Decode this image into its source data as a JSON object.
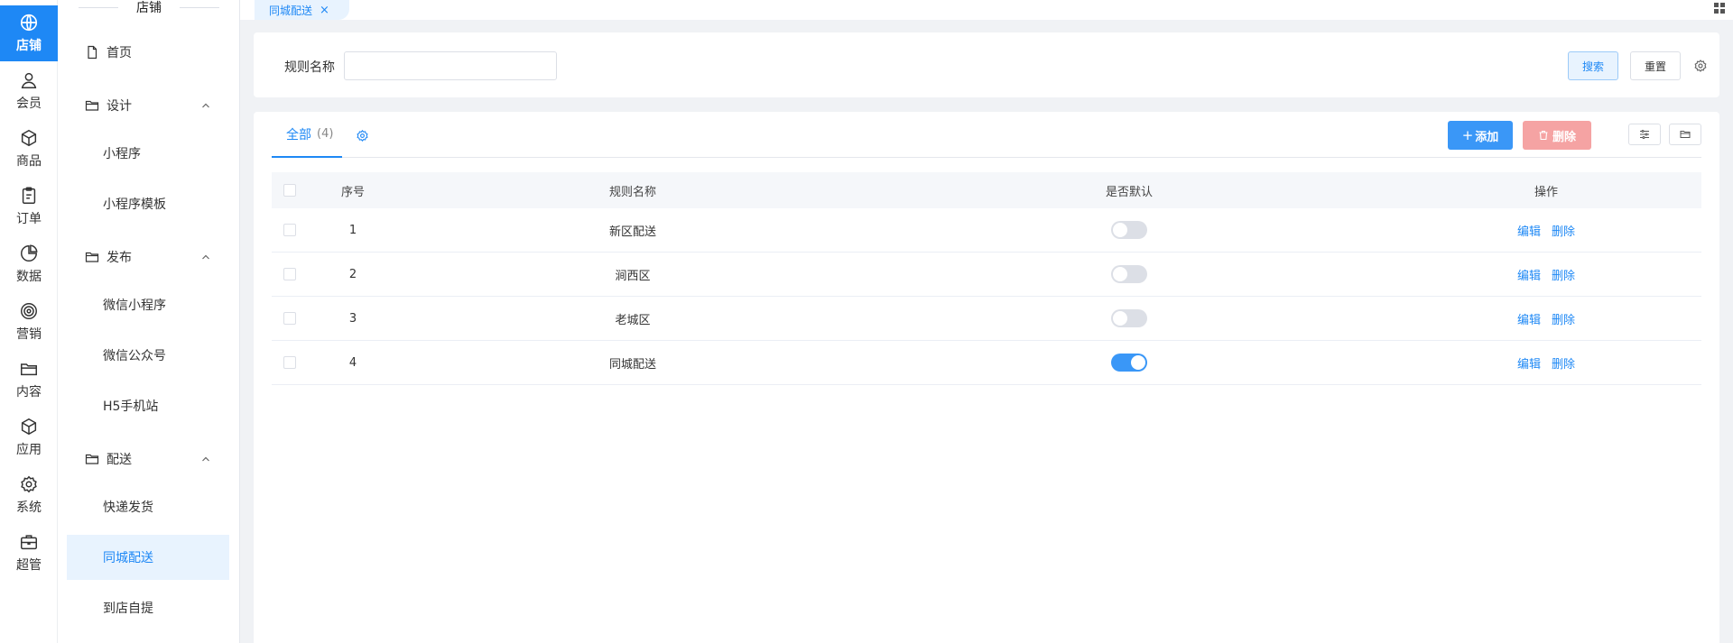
{
  "rail": {
    "items": [
      {
        "label": "店铺",
        "icon": "globe-icon",
        "active": true
      },
      {
        "label": "会员",
        "icon": "user-icon"
      },
      {
        "label": "商品",
        "icon": "box-icon"
      },
      {
        "label": "订单",
        "icon": "clipboard-icon"
      },
      {
        "label": "数据",
        "icon": "pie-chart-icon"
      },
      {
        "label": "营销",
        "icon": "target-icon"
      },
      {
        "label": "内容",
        "icon": "folder-icon"
      },
      {
        "label": "应用",
        "icon": "cube-icon"
      },
      {
        "label": "系统",
        "icon": "gear-icon"
      },
      {
        "label": "超管",
        "icon": "briefcase-icon"
      }
    ]
  },
  "subside": {
    "header": "店铺",
    "items": [
      {
        "label": "首页",
        "level": 1,
        "icon": "document-icon"
      },
      {
        "label": "设计",
        "level": 1,
        "icon": "folder-icon",
        "expandable": true
      },
      {
        "label": "小程序",
        "level": 2
      },
      {
        "label": "小程序模板",
        "level": 2
      },
      {
        "label": "发布",
        "level": 1,
        "icon": "folder-icon",
        "expandable": true
      },
      {
        "label": "微信小程序",
        "level": 2
      },
      {
        "label": "微信公众号",
        "level": 2
      },
      {
        "label": "H5手机站",
        "level": 2
      },
      {
        "label": "配送",
        "level": 1,
        "icon": "folder-icon",
        "expandable": true
      },
      {
        "label": "快递发货",
        "level": 2
      },
      {
        "label": "同城配送",
        "level": 2,
        "active": true
      },
      {
        "label": "到店自提",
        "level": 2
      }
    ]
  },
  "tabbar": {
    "tab_label": "同城配送",
    "close_glyph": "×"
  },
  "search": {
    "label": "规则名称",
    "value": "",
    "placeholder": "",
    "search_label": "搜索",
    "reset_label": "重置"
  },
  "table_panel": {
    "tab_label": "全部",
    "tab_count": "(4)",
    "add_label": "添加",
    "add_glyph": "+",
    "delete_label": "删除"
  },
  "table": {
    "columns": [
      "序号",
      "规则名称",
      "是否默认",
      "操作"
    ],
    "rows": [
      {
        "no": "1",
        "name": "新区配送",
        "default": false
      },
      {
        "no": "2",
        "name": "涧西区",
        "default": false
      },
      {
        "no": "3",
        "name": "老城区",
        "default": false
      },
      {
        "no": "4",
        "name": "同城配送",
        "default": true
      }
    ],
    "edit_label": "编辑",
    "delete_label": "删除"
  },
  "colors": {
    "accent": "#1e88f5",
    "danger_disabled": "#f5a3a3",
    "active_bg": "#e8f3fe"
  }
}
